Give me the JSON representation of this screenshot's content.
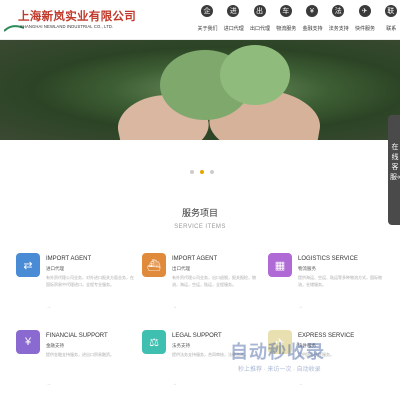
{
  "header": {
    "company_cn": "上海新岚实业有限公司",
    "company_en": "SHANGHAI NEWLAND INDUSTRIAL CO., LTD.",
    "nav": [
      {
        "label": "关于我们",
        "icon": "about-icon",
        "glyph": "企"
      },
      {
        "label": "进口代理",
        "icon": "import-icon",
        "glyph": "进"
      },
      {
        "label": "出口代理",
        "icon": "export-icon",
        "glyph": "出"
      },
      {
        "label": "物流服务",
        "icon": "truck-icon",
        "glyph": "车"
      },
      {
        "label": "金融支持",
        "icon": "finance-icon",
        "glyph": "¥"
      },
      {
        "label": "法务支持",
        "icon": "gavel-icon",
        "glyph": "法"
      },
      {
        "label": "快件服务",
        "icon": "rocket-icon",
        "glyph": "✈"
      },
      {
        "label": "联系",
        "icon": "contact-icon",
        "glyph": "联"
      }
    ]
  },
  "carousel": {
    "dot_count": 3,
    "active_index": 1
  },
  "side_tab": {
    "label": "在线客服«"
  },
  "section": {
    "title": "服务项目",
    "subtitle": "SERVICE ITEMS",
    "cards": [
      {
        "title": "IMPORT AGENT",
        "subtitle": "进口代理",
        "icon": "globe-icon",
        "color": "#4a8bd6",
        "glyph": "⇄",
        "desc": "有外贸代理公司业务，对外进口报关方面业务，在国际贸易中代理进口，全程专业服务。",
        "arrow": "→"
      },
      {
        "title": "IMPORT AGENT",
        "subtitle": "出口代理",
        "icon": "ship-icon",
        "color": "#e08a3c",
        "glyph": "⛴",
        "desc": "有外贸代理公司业务，出口退税，报关报检，物流，海运，空运，陆运，全程服务。",
        "arrow": "→"
      },
      {
        "title": "LOGISTICS SERVICE",
        "subtitle": "物流服务",
        "icon": "logistics-icon",
        "color": "#b06ad6",
        "glyph": "▦",
        "desc": "提供海运、空运、陆运等多种物流方式，国际物流，仓储服务。",
        "arrow": "→"
      },
      {
        "title": "FINANCIAL SUPPORT",
        "subtitle": "金融支持",
        "icon": "money-icon",
        "color": "#8a6ad0",
        "glyph": "¥",
        "desc": "提供金融支持服务，进出口贸易融资。",
        "arrow": "→"
      },
      {
        "title": "LEGAL SUPPORT",
        "subtitle": "法务支持",
        "icon": "gavel-icon",
        "color": "#3fbfb0",
        "glyph": "⚖",
        "desc": "提供法务支持服务，合同审核，法律咨询。",
        "arrow": "→"
      },
      {
        "title": "EXPRESS SERVICE",
        "subtitle": "快件服务",
        "icon": "express-icon",
        "color": "#e8e0b0",
        "glyph": "✈",
        "desc": "提供国际快件服务。",
        "arrow": "→"
      }
    ]
  },
  "watermark": {
    "logo": "自动秒收录",
    "tagline": "秒上推荐 · 来访一次 · 自动收录"
  }
}
